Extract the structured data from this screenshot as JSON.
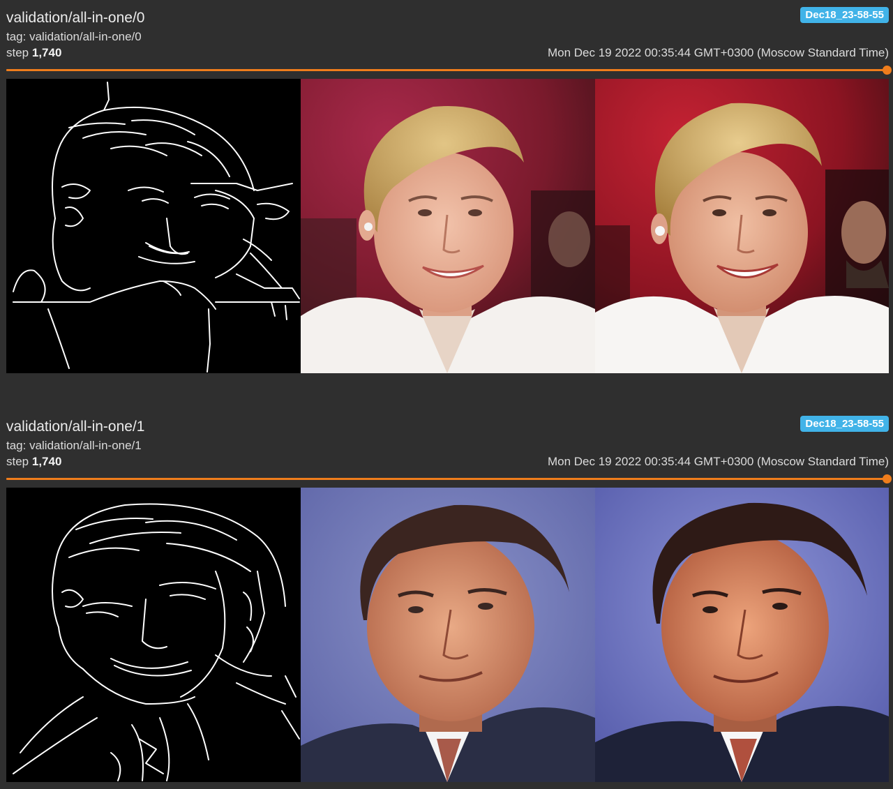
{
  "colors": {
    "background": "#2f2f2f",
    "accent": "#ef7d1c",
    "badge_bg": "#41b3e8"
  },
  "cards": [
    {
      "title": "validation/all-in-one/0",
      "tag_line": "tag: validation/all-in-one/0",
      "step_label": "step",
      "step_value": "1,740",
      "run_badge": "Dec18_23-58-55",
      "timestamp": "Mon Dec 19 2022 00:35:44 GMT+0300 (Moscow Standard Time)",
      "slider_position": 1.0
    },
    {
      "title": "validation/all-in-one/1",
      "tag_line": "tag: validation/all-in-one/1",
      "step_label": "step",
      "step_value": "1,740",
      "run_badge": "Dec18_23-58-55",
      "timestamp": "Mon Dec 19 2022 00:35:44 GMT+0300 (Moscow Standard Time)",
      "slider_position": 1.0
    }
  ]
}
